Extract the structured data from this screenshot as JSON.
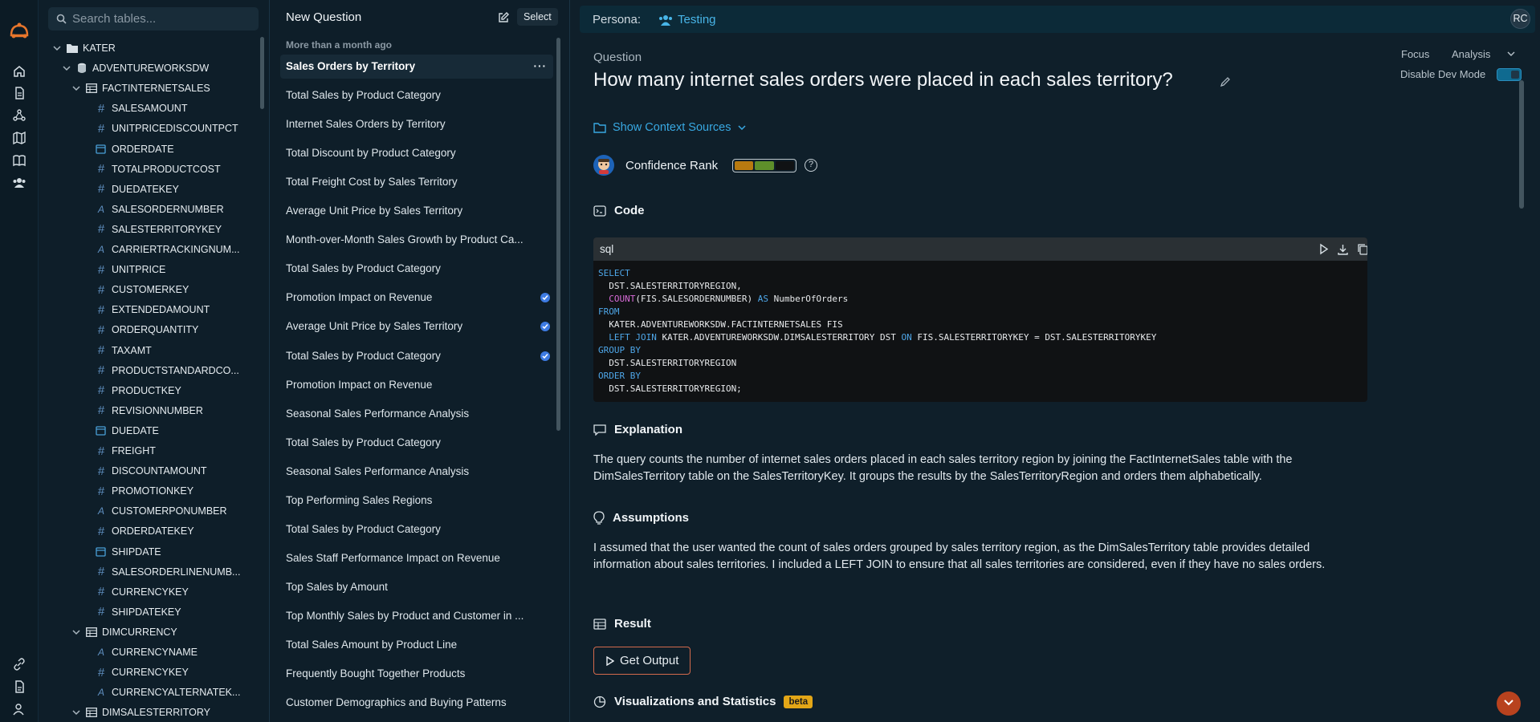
{
  "colors": {
    "accent": "#38a8e2",
    "background": "#0e1e29",
    "confidence": [
      "#b87a10",
      "#5e8f2a",
      "#101214"
    ],
    "get_output_border": "#d36a4c",
    "beta": "#e3a617"
  },
  "rail": {
    "icons": [
      "home-icon",
      "document-icon",
      "graph-icon",
      "map-icon",
      "book-icon",
      "users-icon",
      "link-icon",
      "file-icon",
      "user-settings-icon"
    ]
  },
  "tree": {
    "search_placeholder": "Search tables...",
    "nodes": [
      {
        "label": "KATER",
        "kind": "folder"
      },
      {
        "label": "ADVENTUREWORKSDW",
        "kind": "database"
      },
      {
        "label": "FACTINTERNETSALES",
        "kind": "table"
      },
      {
        "label": "SALESAMOUNT",
        "kind": "number"
      },
      {
        "label": "UNITPRICEDISCOUNTPCT",
        "kind": "number"
      },
      {
        "label": "ORDERDATE",
        "kind": "date"
      },
      {
        "label": "TOTALPRODUCTCOST",
        "kind": "number"
      },
      {
        "label": "DUEDATEKEY",
        "kind": "number"
      },
      {
        "label": "SALESORDERNUMBER",
        "kind": "text"
      },
      {
        "label": "SALESTERRITORYKEY",
        "kind": "number"
      },
      {
        "label": "CARRIERTRACKINGNUM...",
        "kind": "text"
      },
      {
        "label": "UNITPRICE",
        "kind": "number"
      },
      {
        "label": "CUSTOMERKEY",
        "kind": "number"
      },
      {
        "label": "EXTENDEDAMOUNT",
        "kind": "number"
      },
      {
        "label": "ORDERQUANTITY",
        "kind": "number"
      },
      {
        "label": "TAXAMT",
        "kind": "number"
      },
      {
        "label": "PRODUCTSTANDARDCO...",
        "kind": "number"
      },
      {
        "label": "PRODUCTKEY",
        "kind": "number"
      },
      {
        "label": "REVISIONNUMBER",
        "kind": "number"
      },
      {
        "label": "DUEDATE",
        "kind": "date"
      },
      {
        "label": "FREIGHT",
        "kind": "number"
      },
      {
        "label": "DISCOUNTAMOUNT",
        "kind": "number"
      },
      {
        "label": "PROMOTIONKEY",
        "kind": "number"
      },
      {
        "label": "CUSTOMERPONUMBER",
        "kind": "text"
      },
      {
        "label": "ORDERDATEKEY",
        "kind": "number"
      },
      {
        "label": "SHIPDATE",
        "kind": "date"
      },
      {
        "label": "SALESORDERLINENUMB...",
        "kind": "number"
      },
      {
        "label": "CURRENCYKEY",
        "kind": "number"
      },
      {
        "label": "SHIPDATEKEY",
        "kind": "number"
      },
      {
        "label": "DIMCURRENCY",
        "kind": "table"
      },
      {
        "label": "CURRENCYNAME",
        "kind": "text"
      },
      {
        "label": "CURRENCYKEY",
        "kind": "number"
      },
      {
        "label": "CURRENCYALTERNATEK...",
        "kind": "text"
      },
      {
        "label": "DIMSALESTERRITORY",
        "kind": "table"
      }
    ]
  },
  "questions": {
    "title": "New Question",
    "select_label": "Select",
    "group_label": "More than a month ago",
    "more_label": "···",
    "items": [
      {
        "label": "Sales Orders by Territory",
        "active": true
      },
      {
        "label": "Total Sales by Product Category"
      },
      {
        "label": "Internet Sales Orders by Territory"
      },
      {
        "label": "Total Discount by Product Category"
      },
      {
        "label": "Total Freight Cost by Sales Territory"
      },
      {
        "label": "Average Unit Price by Sales Territory"
      },
      {
        "label": "Month-over-Month Sales Growth by Product Ca..."
      },
      {
        "label": "Total Sales by Product Category"
      },
      {
        "label": "Promotion Impact on Revenue",
        "verified": true
      },
      {
        "label": "Average Unit Price by Sales Territory",
        "verified": true
      },
      {
        "label": "Total Sales by Product Category",
        "verified": true
      },
      {
        "label": "Promotion Impact on Revenue"
      },
      {
        "label": "Seasonal Sales Performance Analysis"
      },
      {
        "label": "Total Sales by Product Category"
      },
      {
        "label": "Seasonal Sales Performance Analysis"
      },
      {
        "label": "Top Performing Sales Regions"
      },
      {
        "label": "Total Sales by Product Category"
      },
      {
        "label": "Sales Staff Performance Impact on Revenue"
      },
      {
        "label": "Top Sales by Amount"
      },
      {
        "label": "Top Monthly Sales by Product and Customer in ..."
      },
      {
        "label": "Total Sales Amount by Product Line"
      },
      {
        "label": "Frequently Bought Together Products"
      },
      {
        "label": "Customer Demographics and Buying Patterns"
      }
    ]
  },
  "header": {
    "persona_label": "Persona:",
    "persona_name": "Testing",
    "avatar_initials": "RC"
  },
  "modes": {
    "focus": "Focus",
    "analysis": "Analysis",
    "dev_mode": "Disable Dev Mode"
  },
  "question": {
    "label": "Question",
    "title": "How many internet sales orders were placed in each sales territory?",
    "context_label": "Show Context Sources",
    "confidence_label": "Confidence Rank"
  },
  "code": {
    "heading": "Code",
    "lang": "sql",
    "lines": [
      [
        "SELECT"
      ],
      [
        "  DST.SALESTERRITORYREGION,"
      ],
      [
        "  COUNT(FIS.SALESORDERNUMBER) AS NumberOfOrders"
      ],
      [
        "FROM"
      ],
      [
        "  KATER.ADVENTUREWORKSDW.FACTINTERNETSALES FIS"
      ],
      [
        "  LEFT JOIN KATER.ADVENTUREWORKSDW.DIMSALESTERRITORY DST ON FIS.SALESTERRITORYKEY = DST.SALESTERRITORYKEY"
      ],
      [
        "GROUP BY"
      ],
      [
        "  DST.SALESTERRITORYREGION"
      ],
      [
        "ORDER BY"
      ],
      [
        "  DST.SALESTERRITORYREGION;"
      ]
    ]
  },
  "explanation": {
    "heading": "Explanation",
    "text": "The query counts the number of internet sales orders placed in each sales territory region by joining the FactInternetSales table with the DimSalesTerritory table on the SalesTerritoryKey. It groups the results by the SalesTerritoryRegion and orders them alphabetically."
  },
  "assumptions": {
    "heading": "Assumptions",
    "text": "I assumed that the user wanted the count of sales orders grouped by sales territory region, as the DimSalesTerritory table provides detailed information about sales territories. I included a LEFT JOIN to ensure that all sales territories are considered, even if they have no sales orders."
  },
  "result": {
    "heading": "Result",
    "button": "Get Output"
  },
  "visualizations": {
    "heading": "Visualizations and Statistics",
    "badge": "beta"
  }
}
